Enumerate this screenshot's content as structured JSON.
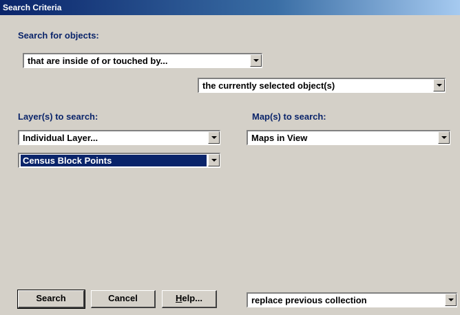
{
  "window": {
    "title": "Search Criteria"
  },
  "search_for": {
    "label": "Search for objects:",
    "spatial_relation": "that are inside of or touched by...",
    "target": "the currently selected object(s)"
  },
  "layers": {
    "label": "Layer(s) to search:",
    "mode": "Individual Layer...",
    "layer": "Census Block Points"
  },
  "maps": {
    "label": "Map(s) to search:",
    "value": "Maps in View"
  },
  "buttons": {
    "search": "Search",
    "cancel": "Cancel",
    "help_hotkey": "H",
    "help_rest": "elp..."
  },
  "collection_mode": "replace previous collection"
}
